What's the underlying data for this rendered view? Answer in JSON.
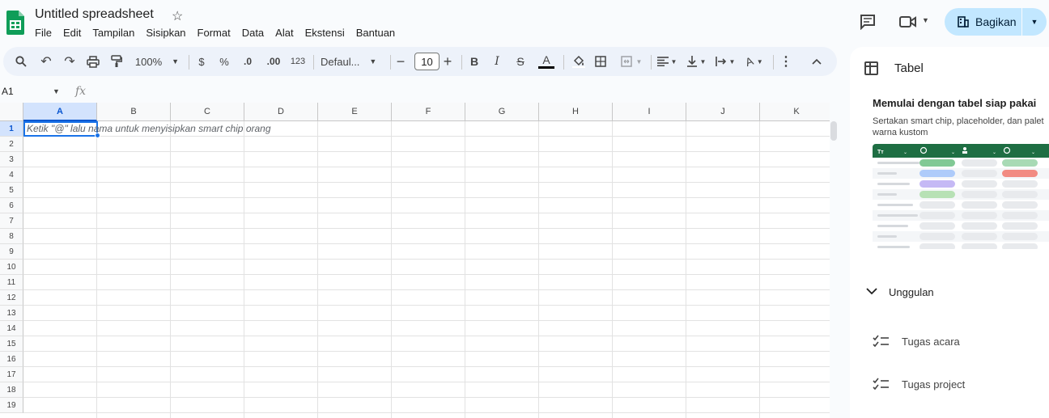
{
  "header": {
    "title": "Untitled spreadsheet",
    "menu": [
      "File",
      "Edit",
      "Tampilan",
      "Sisipkan",
      "Format",
      "Data",
      "Alat",
      "Ekstensi",
      "Bantuan"
    ],
    "share_label": "Bagikan",
    "icons": [
      "sheets-logo",
      "star-icon",
      "comment-icon",
      "meet-icon",
      "share-caret-icon"
    ]
  },
  "toolbar": {
    "zoom": "100%",
    "currency": "$",
    "percent": "%",
    "dec_decrease": ".0",
    "dec_increase": ".00",
    "number_format": "123",
    "font_family": "Defaul...",
    "font_size": "10",
    "bold": "B",
    "italic": "I",
    "strike": "S",
    "text_color": "A",
    "rotate": "A"
  },
  "formula_bar": {
    "name_box": "A1",
    "fx": "fx"
  },
  "grid": {
    "columns": [
      "A",
      "B",
      "C",
      "D",
      "E",
      "F",
      "G",
      "H",
      "I",
      "J",
      "K"
    ],
    "rows": [
      "1",
      "2",
      "3",
      "4",
      "5",
      "6",
      "7",
      "8",
      "9",
      "10",
      "11",
      "12",
      "13",
      "14",
      "15",
      "16",
      "17",
      "18",
      "19"
    ],
    "selected_cell": "A1",
    "placeholder": "Ketik \"@\" lalu nama untuk menyisipkan smart chip orang"
  },
  "side_panel": {
    "title": "Tabel",
    "heading": "Memulai dengan tabel siap pakai",
    "description": "Sertakan smart chip, placeholder, dan palet warna kustom",
    "section": "Unggulan",
    "templates": [
      {
        "label": "Tugas acara"
      },
      {
        "label": "Tugas project"
      }
    ]
  },
  "colors": {
    "accent": "#0b57d0",
    "share_bg": "#c2e7ff",
    "toolbar_bg": "#edf2fa",
    "sheets_green": "#0f9d58",
    "preview_header": "#1e6e43"
  }
}
